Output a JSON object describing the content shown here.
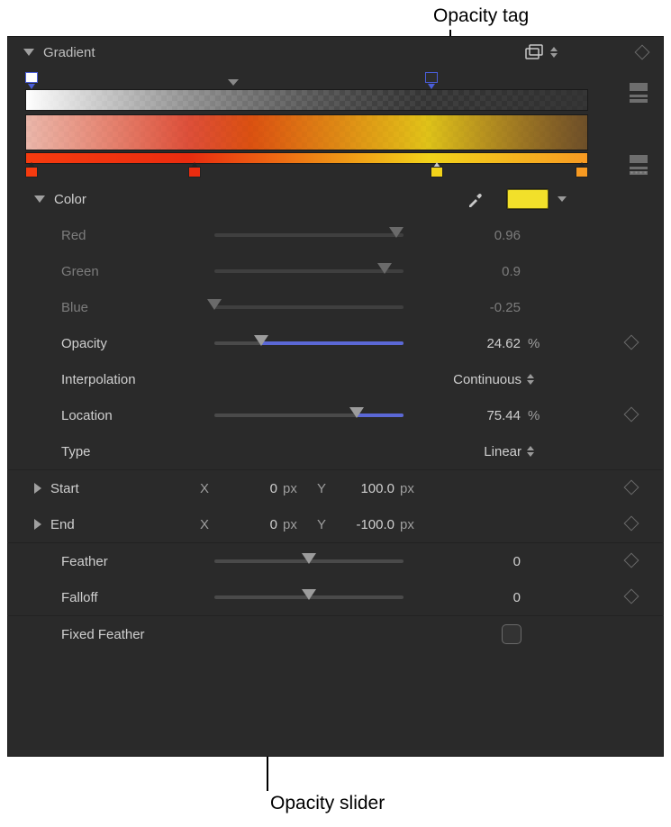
{
  "callouts": {
    "opacity_tag": "Opacity tag",
    "opacity_slider": "Opacity slider"
  },
  "header": {
    "title": "Gradient"
  },
  "gradient": {
    "opacity_tags": [
      {
        "pos_pct": 0,
        "color": "#ffffff"
      },
      {
        "pos_pct": 71,
        "color": "#2d2d2d",
        "selected": true
      }
    ],
    "opacity_mid_pct": 36,
    "color_stops": [
      {
        "pos_pct": 0,
        "color": "#f63b0f"
      },
      {
        "pos_pct": 29,
        "color": "#ea2c0f"
      },
      {
        "pos_pct": 72,
        "color": "#f2d31a",
        "selected": true
      },
      {
        "pos_pct": 100,
        "color": "#f79a22"
      }
    ]
  },
  "color": {
    "label": "Color",
    "swatch": "#f2e02a",
    "red": {
      "label": "Red",
      "value": "0.96",
      "frac": 0.96
    },
    "green": {
      "label": "Green",
      "value": "0.9",
      "frac": 0.9
    },
    "blue": {
      "label": "Blue",
      "value": "-0.25",
      "frac": 0.0
    }
  },
  "opacity": {
    "label": "Opacity",
    "value": "24.62",
    "unit": "%",
    "frac": 0.2462
  },
  "interpolation": {
    "label": "Interpolation",
    "value": "Continuous"
  },
  "location": {
    "label": "Location",
    "value": "75.44",
    "unit": "%",
    "frac": 0.7544
  },
  "type": {
    "label": "Type",
    "value": "Linear"
  },
  "start": {
    "label": "Start",
    "x": "0",
    "y": "100.0",
    "unit": "px"
  },
  "end": {
    "label": "End",
    "x": "0",
    "y": "-100.0",
    "unit": "px"
  },
  "feather": {
    "label": "Feather",
    "value": "0",
    "frac": 0.5
  },
  "falloff": {
    "label": "Falloff",
    "value": "0",
    "frac": 0.5
  },
  "fixed_feather": {
    "label": "Fixed Feather",
    "checked": false
  }
}
